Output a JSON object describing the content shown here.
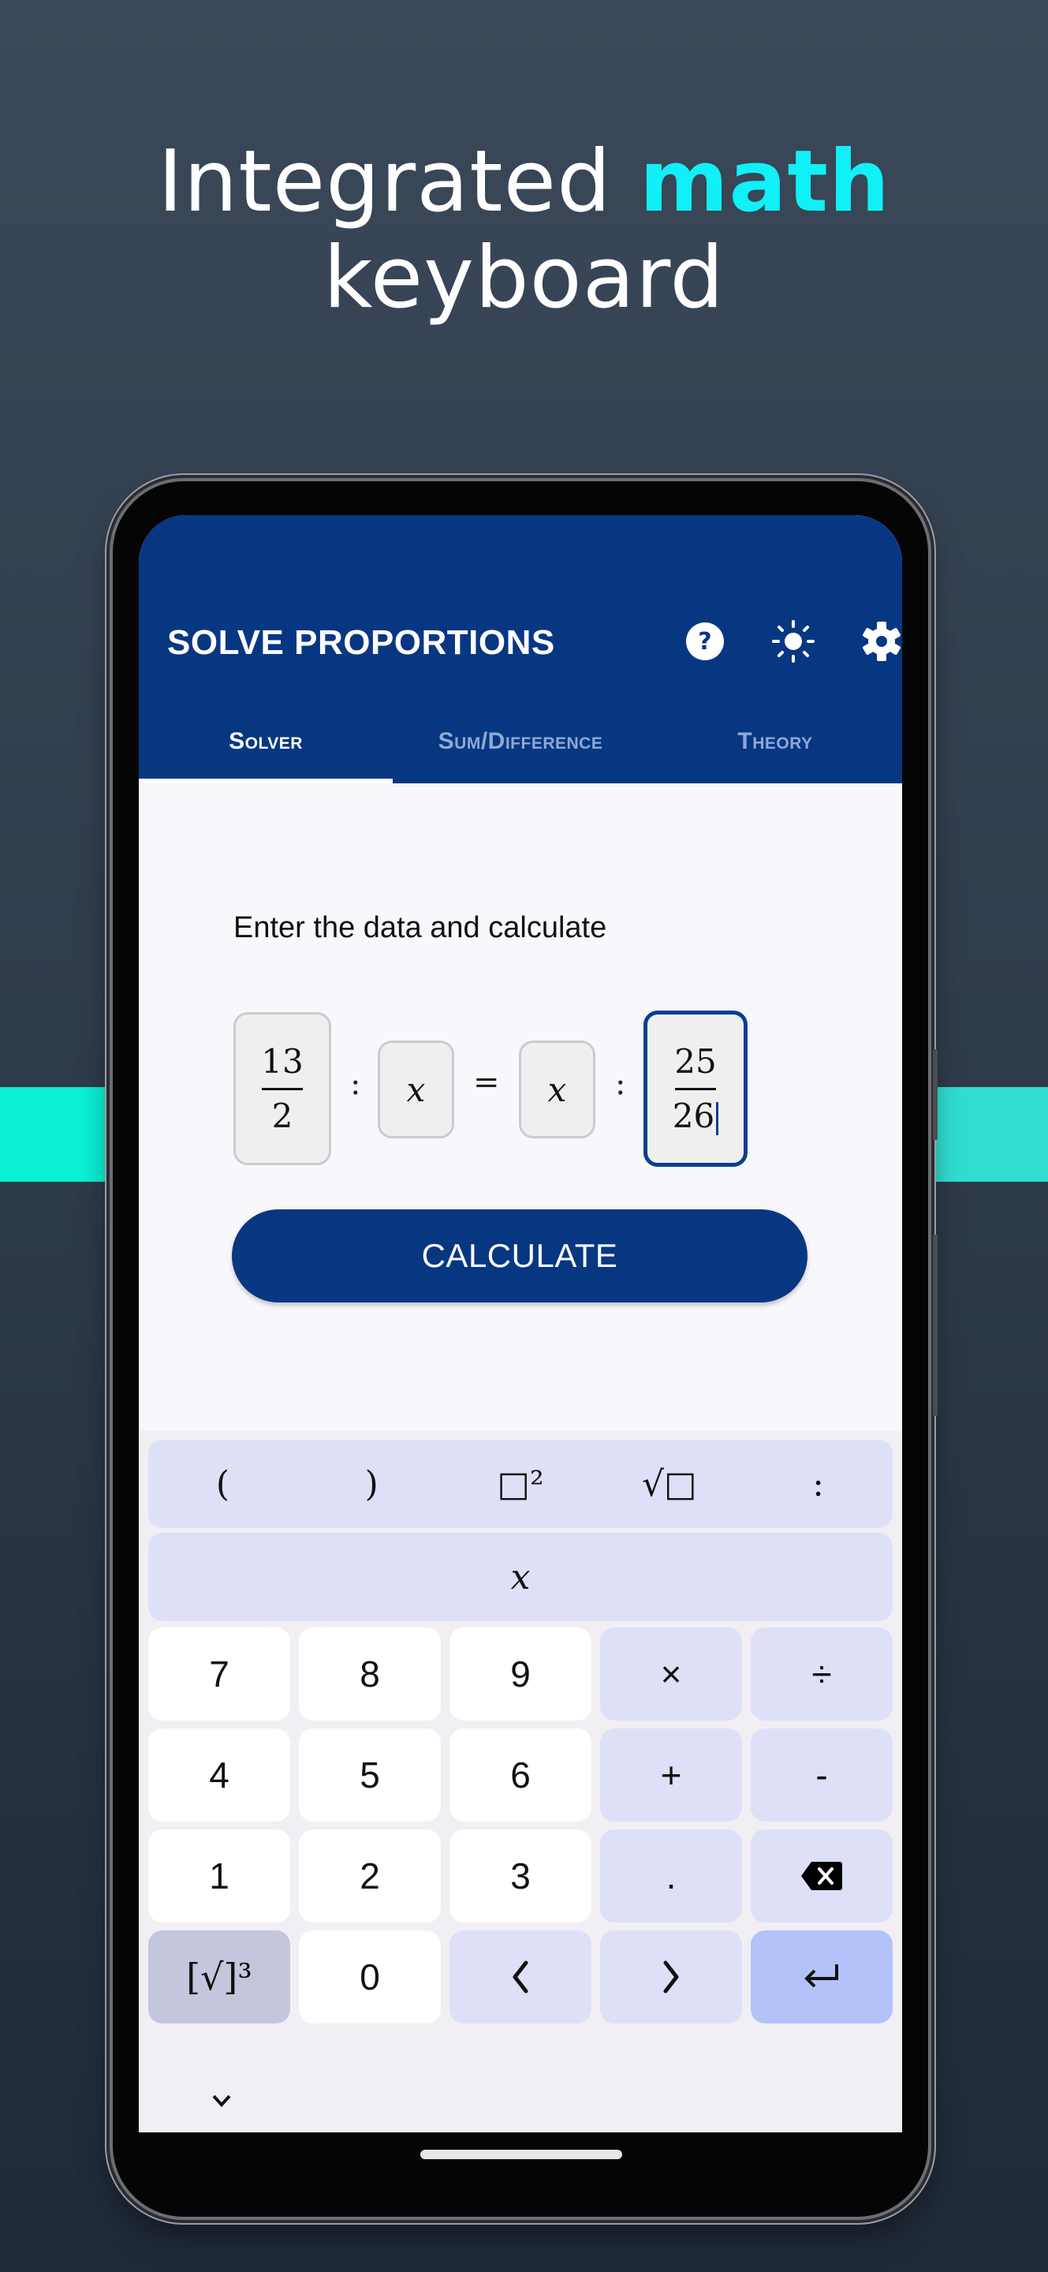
{
  "headline": {
    "line1_prefix": "Integrated ",
    "line1_accent": "math",
    "line2": "keyboard"
  },
  "colors": {
    "accent_cyan": "#10f0f6",
    "app_primary": "#083782",
    "stripe": "#0af0d4"
  },
  "appbar": {
    "title": "SOLVE PROPORTIONS",
    "icons": [
      "help-icon",
      "brightness-icon",
      "settings-icon"
    ]
  },
  "tabs": [
    {
      "label": "Solver",
      "active": true
    },
    {
      "label": "Sum/Difference",
      "active": false
    },
    {
      "label": "Theory",
      "active": false
    }
  ],
  "solver": {
    "prompt": "Enter the data and calculate",
    "equation": {
      "a": {
        "numerator": "13",
        "denominator": "2"
      },
      "sep1": ":",
      "b": "x",
      "equals": "=",
      "c": "x",
      "sep2": ":",
      "d": {
        "numerator": "25",
        "denominator": "26"
      }
    },
    "calculate_label": "CALCULATE"
  },
  "keyboard": {
    "row_symbols": [
      "(",
      ")",
      "□²",
      "√□",
      ":"
    ],
    "row_variable": "x",
    "rows": [
      [
        "7",
        "8",
        "9",
        "×",
        "÷"
      ],
      [
        "4",
        "5",
        "6",
        "+",
        "-"
      ],
      [
        "1",
        "2",
        "3",
        ".",
        "⌫"
      ],
      [
        "[√]³",
        "0",
        "‹",
        "›",
        "↵"
      ]
    ],
    "collapse_label": "⌄"
  }
}
